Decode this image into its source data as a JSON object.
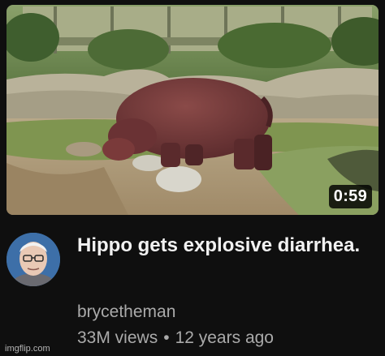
{
  "video": {
    "duration": "0:59",
    "thumbnail_icon": "hippo-thumbnail-image",
    "title": "Hippo gets explosive diarrhea.",
    "channel": "brycetheman",
    "views": "33M views",
    "separator": "•",
    "age": "12 years ago"
  },
  "avatar_icon": "channel-avatar-image",
  "watermark": "imgflip.com",
  "colors": {
    "background": "#0f0f0f",
    "title_text": "#f1f1f1",
    "secondary_text": "#aaaaaa"
  }
}
